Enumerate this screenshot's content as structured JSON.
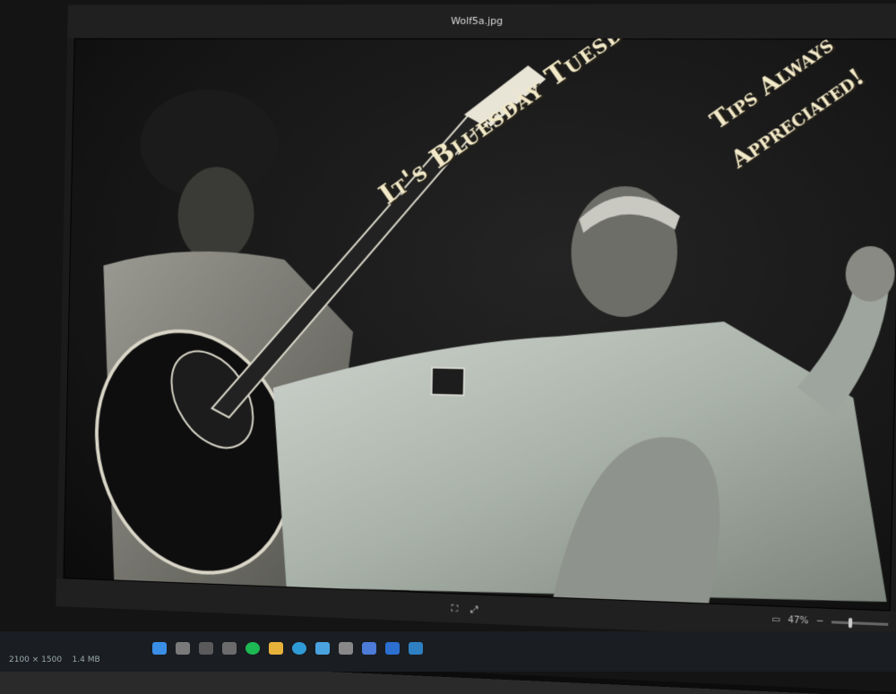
{
  "window": {
    "title": "Wolf5a.jpg"
  },
  "photo": {
    "headline": "It's Bluesday Tuesday!",
    "tips_line1": "Tips Always",
    "tips_line2": "Appreciated!"
  },
  "statusbar": {
    "dimensions": "2100 × 1500",
    "file_size": "1.4 MB",
    "zoom": "47%"
  },
  "taskbar": {
    "icons": [
      "windows-icon",
      "search-icon",
      "taskview-icon",
      "widgets-icon",
      "chat-icon",
      "explorer-icon",
      "edge-icon",
      "spotify-icon",
      "photos-icon",
      "settings-icon",
      "store-icon",
      "mail-icon",
      "app-icon",
      "vscode-icon"
    ]
  },
  "colors": {
    "text_cream": "#f2e9c8",
    "photo_bg": "#141414"
  }
}
